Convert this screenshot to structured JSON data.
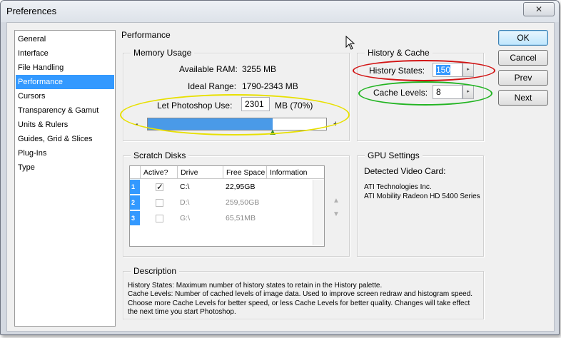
{
  "window": {
    "title": "Preferences",
    "close_glyph": "✕"
  },
  "sidebar": {
    "items": [
      {
        "label": "General"
      },
      {
        "label": "Interface"
      },
      {
        "label": "File Handling"
      },
      {
        "label": "Performance"
      },
      {
        "label": "Cursors"
      },
      {
        "label": "Transparency & Gamut"
      },
      {
        "label": "Units & Rulers"
      },
      {
        "label": "Guides, Grid & Slices"
      },
      {
        "label": "Plug-Ins"
      },
      {
        "label": "Type"
      }
    ],
    "selected": "Performance"
  },
  "page_title": "Performance",
  "memory": {
    "title": "Memory Usage",
    "available_label": "Available RAM:",
    "available_value": "3255 MB",
    "ideal_label": "Ideal Range:",
    "ideal_value": "1790-2343 MB",
    "let_label": "Let Photoshop Use:",
    "let_value": "2301",
    "let_unit": "MB (70%)",
    "minus": "-",
    "plus": "+",
    "slider_fraction": 0.7
  },
  "history": {
    "title": "History & Cache",
    "states_label": "History States:",
    "states_value": "150",
    "cache_label": "Cache Levels:",
    "cache_value": "8",
    "spin_glyph": "▸"
  },
  "buttons": {
    "ok": "OK",
    "cancel": "Cancel",
    "prev": "Prev",
    "next": "Next"
  },
  "scratch": {
    "title": "Scratch Disks",
    "columns": [
      "Active?",
      "Drive",
      "Free Space",
      "Information"
    ],
    "rows": [
      {
        "num": "1",
        "active": true,
        "check": "✓",
        "drive": "C:\\",
        "free": "22,95GB"
      },
      {
        "num": "2",
        "active": false,
        "check": "",
        "drive": "D:\\",
        "free": "259,50GB"
      },
      {
        "num": "3",
        "active": false,
        "check": "",
        "drive": "G:\\",
        "free": "65,51MB"
      }
    ],
    "up_glyph": "▲",
    "down_glyph": "▼"
  },
  "gpu": {
    "title": "GPU Settings",
    "detected_label": "Detected Video Card:",
    "line1": "ATI Technologies Inc.",
    "line2": "ATI Mobility Radeon HD 5400 Series"
  },
  "description": {
    "title": "Description",
    "lines": [
      "History States: Maximum number of history states to retain in the History palette.",
      "Cache Levels: Number of cached levels of image data.  Used to improve screen redraw and histogram speed.",
      "Choose more Cache Levels for better speed, or less Cache Levels for better quality. Changes will take effect",
      "the next time you start Photoshop."
    ]
  },
  "colors": {
    "selection": "#3399ff",
    "annotation_yellow": "#e8e000",
    "annotation_red": "#d21414",
    "annotation_green": "#22b422"
  }
}
